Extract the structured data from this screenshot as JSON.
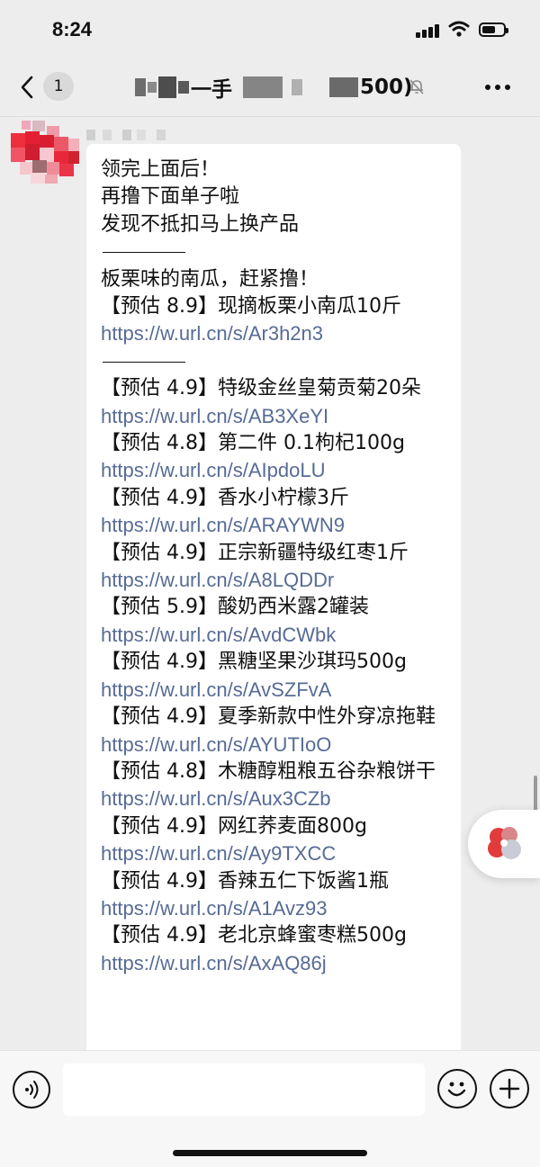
{
  "status_bar": {
    "time": "8:24",
    "icons": [
      "cellular-signal-icon",
      "wifi-icon",
      "battery-icon"
    ]
  },
  "nav": {
    "unread_count": "1",
    "title_part1": "一手",
    "title_part2": "500)",
    "icons": [
      "back-chevron-icon",
      "mute-bell-icon",
      "more-dots-icon"
    ]
  },
  "message": {
    "lines": [
      "领完上面后！",
      "再撸下面单子啦",
      "发现不抵扣马上换产品",
      "板栗味的南瓜，赶紧撸！"
    ],
    "items": [
      {
        "text": "【预估 8.9】现摘板栗小南瓜10斤",
        "link": "https://w.url.cn/s/Ar3h2n3"
      },
      {
        "text": "【预估 4.9】特级金丝皇菊贡菊20朵",
        "link": "https://w.url.cn/s/AB3XeYI"
      },
      {
        "text": "【预估 4.8】第二件 0.1枸杞100g",
        "link": "https://w.url.cn/s/AIpdoLU"
      },
      {
        "text": "【预估 4.9】香水小柠檬3斤",
        "link": "https://w.url.cn/s/ARAYWN9"
      },
      {
        "text": "【预估 4.9】正宗新疆特级红枣1斤",
        "link": "https://w.url.cn/s/A8LQDDr"
      },
      {
        "text": "【预估 5.9】酸奶西米露2罐装",
        "link": "https://w.url.cn/s/AvdCWbk"
      },
      {
        "text": "【预估 4.9】黑糖坚果沙琪玛500g",
        "link": "https://w.url.cn/s/AvSZFvA"
      },
      {
        "text": "【预估 4.9】夏季新款中性外穿凉拖鞋",
        "link": "https://w.url.cn/s/AYUTIoO"
      },
      {
        "text": "【预估 4.8】木糖醇粗粮五谷杂粮饼干",
        "link": "https://w.url.cn/s/Aux3CZb"
      },
      {
        "text": "【预估 4.9】网红荞麦面800g",
        "link": "https://w.url.cn/s/Ay9TXCC"
      },
      {
        "text": "【预估 4.9】香辣五仁下饭酱1瓶",
        "link": "https://w.url.cn/s/A1Avz93"
      },
      {
        "text": "【预估 4.9】老北京蜂蜜枣糕500g",
        "link": "https://w.url.cn/s/AxAQ86j"
      }
    ]
  },
  "input_bar": {
    "placeholder": "",
    "icons": [
      "voice-icon",
      "emoji-icon",
      "plus-icon"
    ]
  },
  "colors": {
    "link": "#576b95",
    "background": "#ededed",
    "bubble": "#ffffff"
  }
}
